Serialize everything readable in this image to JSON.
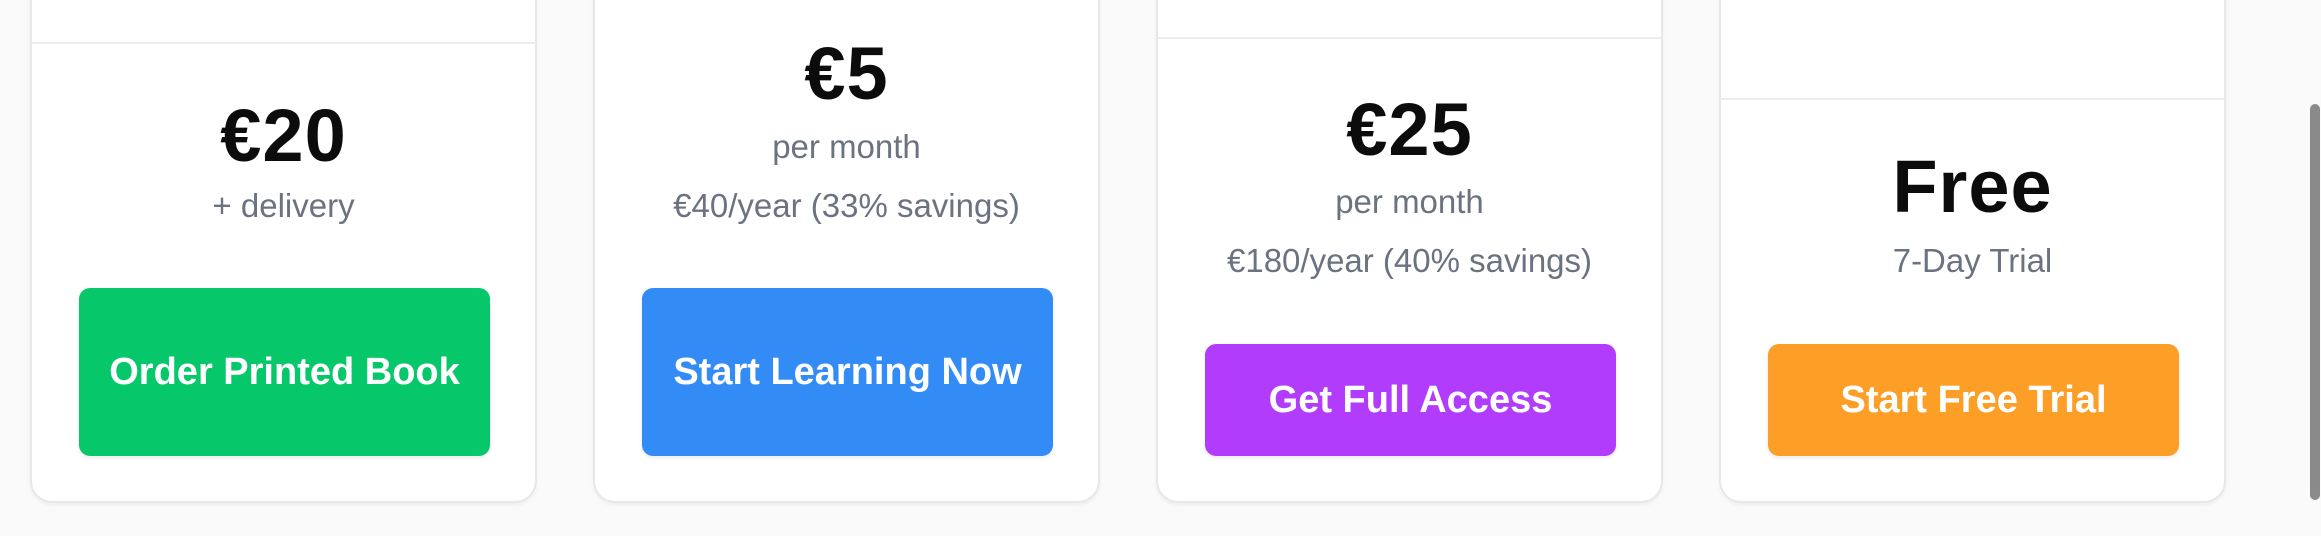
{
  "plans": [
    {
      "price": "€20",
      "sub1": "+ delivery",
      "sub2": "",
      "button": "Order Printed Book",
      "color": "#06c86b"
    },
    {
      "price": "€5",
      "sub1": "per month",
      "sub2": "€40/year (33% savings)",
      "button": "Start Learning Now",
      "color": "#338bf6"
    },
    {
      "price": "€25",
      "sub1": "per month",
      "sub2": "€180/year (40% savings)",
      "button": "Get Full Access",
      "color": "#b13cfb"
    },
    {
      "price": "Free",
      "sub1": "7-Day Trial",
      "sub2": "",
      "button": "Start Free Trial",
      "color": "#fd9e26"
    }
  ]
}
